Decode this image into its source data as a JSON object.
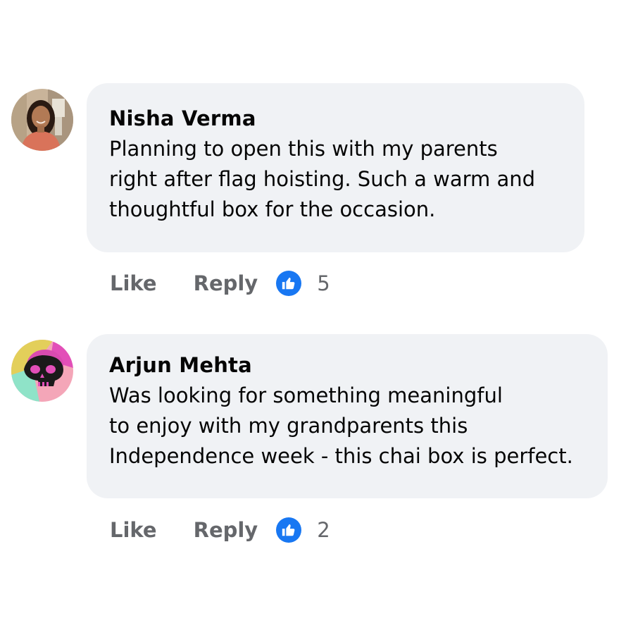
{
  "colors": {
    "bubble_bg": "#f0f2f5",
    "text_primary": "#050505",
    "text_secondary": "#65676b",
    "reaction_blue": "#1877f2"
  },
  "comments": [
    {
      "author": "Nisha Verma",
      "avatar_icon": "avatar-photo-woman",
      "lines": [
        "Planning to open this with my parents",
        "right after flag hoisting. Such a warm and",
        "thoughtful box for the occasion."
      ],
      "like_label": "Like",
      "reply_label": "Reply",
      "reaction_icon": "thumbs-up-icon",
      "reaction_count": "5"
    },
    {
      "author": "Arjun Mehta",
      "avatar_icon": "avatar-skull-art",
      "lines": [
        "Was looking for something meaningful",
        "to enjoy with my grandparents this",
        "Independence week - this chai box is perfect."
      ],
      "like_label": "Like",
      "reply_label": "Reply",
      "reaction_icon": "thumbs-up-icon",
      "reaction_count": "2"
    }
  ]
}
